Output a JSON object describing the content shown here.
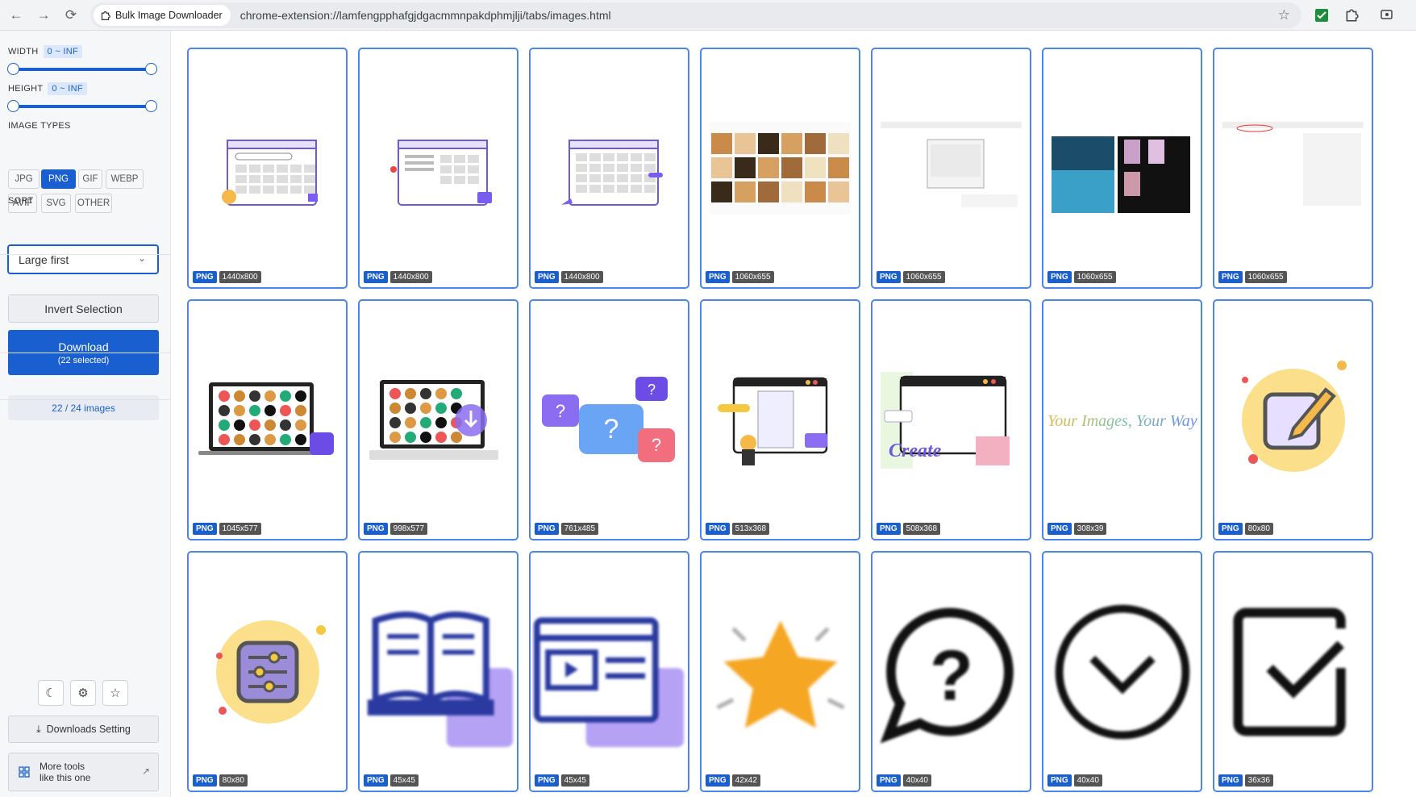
{
  "browser": {
    "tab_title": "Bulk Image Downloader",
    "url": "chrome-extension://lamfengpphafgjdgacmmnpakdphmjlji/tabs/images.html",
    "back_icon": "arrow-left-icon",
    "forward_icon": "arrow-right-icon",
    "reload_icon": "reload-icon"
  },
  "sidebar": {
    "width_label": "WIDTH",
    "width_range": "0 ~ INF",
    "height_label": "HEIGHT",
    "height_range": "0 ~ INF",
    "types_label": "IMAGE TYPES",
    "types": [
      {
        "label": "JPG",
        "active": false
      },
      {
        "label": "PNG",
        "active": true
      },
      {
        "label": "GIF",
        "active": false
      },
      {
        "label": "WEBP",
        "active": false
      },
      {
        "label": "AVIF",
        "active": false
      },
      {
        "label": "SVG",
        "active": false
      },
      {
        "label": "OTHER",
        "active": false
      }
    ],
    "sort_label": "SORT",
    "sort_value": "Large first",
    "invert_label": "Invert Selection",
    "download_label": "Download",
    "download_sub": "(22 selected)",
    "count_label": "22 / 24 images",
    "downloads_setting": "Downloads Setting",
    "more_tools_1": "More tools",
    "more_tools_2": "like this one"
  },
  "images": [
    {
      "type": "PNG",
      "size": "1440x800",
      "kind": "search-ui"
    },
    {
      "type": "PNG",
      "size": "1440x800",
      "kind": "page-ui"
    },
    {
      "type": "PNG",
      "size": "1440x800",
      "kind": "grid-ui"
    },
    {
      "type": "PNG",
      "size": "1060x655",
      "kind": "screenshot-photos"
    },
    {
      "type": "PNG",
      "size": "1060x655",
      "kind": "screenshot-dialog"
    },
    {
      "type": "PNG",
      "size": "1060x655",
      "kind": "screenshot-dark"
    },
    {
      "type": "PNG",
      "size": "1060x655",
      "kind": "screenshot-blank"
    },
    {
      "type": "PNG",
      "size": "1045x577",
      "kind": "laptop"
    },
    {
      "type": "PNG",
      "size": "998x577",
      "kind": "laptop-download"
    },
    {
      "type": "PNG",
      "size": "761x485",
      "kind": "questions"
    },
    {
      "type": "PNG",
      "size": "513x368",
      "kind": "select-person"
    },
    {
      "type": "PNG",
      "size": "508x368",
      "kind": "create"
    },
    {
      "type": "PNG",
      "size": "308x39",
      "kind": "script-text",
      "text": "Your Images, Your Way"
    },
    {
      "type": "PNG",
      "size": "80x80",
      "kind": "edit-circle"
    },
    {
      "type": "PNG",
      "size": "80x80",
      "kind": "sliders-circle"
    },
    {
      "type": "PNG",
      "size": "45x45",
      "kind": "book"
    },
    {
      "type": "PNG",
      "size": "45x45",
      "kind": "video-page"
    },
    {
      "type": "PNG",
      "size": "42x42",
      "kind": "star"
    },
    {
      "type": "PNG",
      "size": "40x40",
      "kind": "question-bubble"
    },
    {
      "type": "PNG",
      "size": "40x40",
      "kind": "chevron-circle"
    },
    {
      "type": "PNG",
      "size": "36x36",
      "kind": "checkbox"
    }
  ],
  "colors": {
    "accent": "#1a5fd0",
    "card_border": "#4a86e8",
    "purple": "#7b5cf0"
  }
}
